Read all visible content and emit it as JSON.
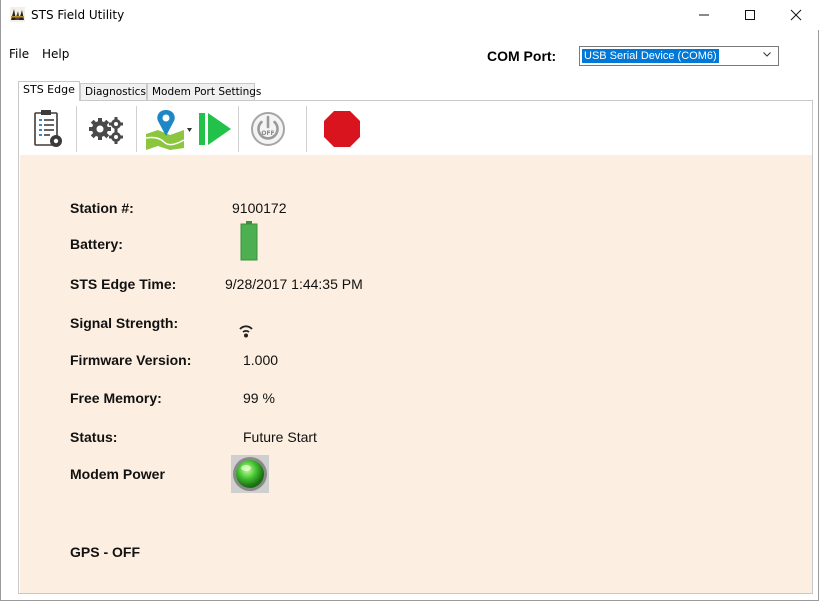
{
  "window": {
    "title": "STS Field Utility"
  },
  "menu": {
    "items": [
      "File",
      "Help"
    ]
  },
  "com_port": {
    "label": "COM Port:",
    "value": "USB Serial Device (COM6)"
  },
  "tabs": [
    "STS Edge",
    "Diagnostics",
    "Modem Port Settings"
  ],
  "toolbar": {
    "icons": [
      "clipboard-settings-icon",
      "gears-icon",
      "map-location-icon",
      "play-icon",
      "power-off-icon",
      "stop-icon"
    ],
    "power_text": "OFF",
    "colors": {
      "play": "#22c24a",
      "stop": "#d9141e",
      "power": "#9a9a9a",
      "pin": "#1e88c7"
    }
  },
  "status": {
    "station_label": "Station #:",
    "station_value": "9100172",
    "battery_label": "Battery:",
    "battery_level": 1.0,
    "time_label": "STS Edge Time:",
    "time_value": "9/28/2017 1:44:35 PM",
    "signal_label": "Signal Strength:",
    "firmware_label": "Firmware Version:",
    "firmware_value": "1.000",
    "memory_label": "Free Memory:",
    "memory_value": "99 %",
    "status_label": "Status:",
    "status_value": "Future Start",
    "modem_label": "Modem Power",
    "modem_state_color": "#3fbf2e",
    "gps_label": "GPS - OFF"
  },
  "colors": {
    "panel_bg": "#fcefe1",
    "accent": "#0078d7",
    "battery": "#4caf50"
  }
}
